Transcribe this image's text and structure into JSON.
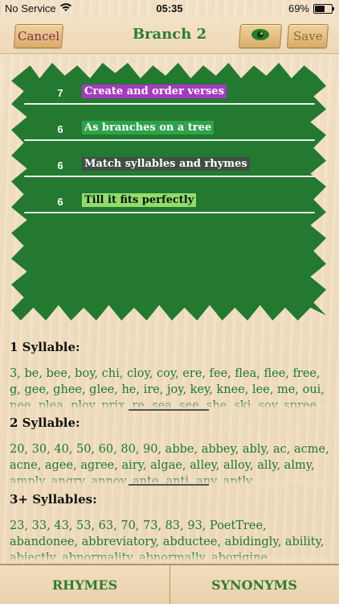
{
  "status_bar": {
    "carrier": "No Service",
    "time": "05:35",
    "battery_text": "69%",
    "battery_level": 0.69
  },
  "nav": {
    "cancel_label": "Cancel",
    "title": "Branch 2",
    "save_label": "Save",
    "eye_icon": "eye-icon"
  },
  "verses": [
    {
      "count": "7",
      "text": "Create and order verses",
      "highlight": "#a73ac2",
      "text_color": "#ffffff"
    },
    {
      "count": "6",
      "text": "As branches on a tree",
      "highlight": "#2ea34a",
      "text_color": "#ffffff"
    },
    {
      "count": "6",
      "text": "Match syllables and rhymes",
      "highlight": "#3f4f43",
      "text_color": "#ffffff"
    },
    {
      "count": "6",
      "text": "Till it fits perfectly",
      "highlight": "#8fde6a",
      "text_color": "#111111"
    }
  ],
  "sections": [
    {
      "title": "1 Syllable:",
      "words": "3, be, bee, boy, chi, cloy, coy, ere, fee, flea, flee, free, g, gee, ghee, glee, he, ire, joy, key, knee, lee, me, oui, nee, plea, ploy, prix, re, sea, see, she, ski, soy, spree"
    },
    {
      "title": "2 Syllable:",
      "words": "20, 30, 40, 50, 60, 80, 90, abbe, abbey, ably, ac, acme, acne, agee, agree, airy, algae, alley, alloy, ally, almy, amply, angry, annoy, ante, anti, any, aptly"
    },
    {
      "title": "3+ Syllables:",
      "words": "23, 33, 43, 53, 63, 70, 73, 83, 93, PoetTree, abandonee, abbreviatory, abductee, abidingly, ability, abjectly, abnormality, abnormally, aborigine"
    }
  ],
  "tabs": {
    "rhymes": "RHYMES",
    "synonyms": "SYNONYMS"
  }
}
